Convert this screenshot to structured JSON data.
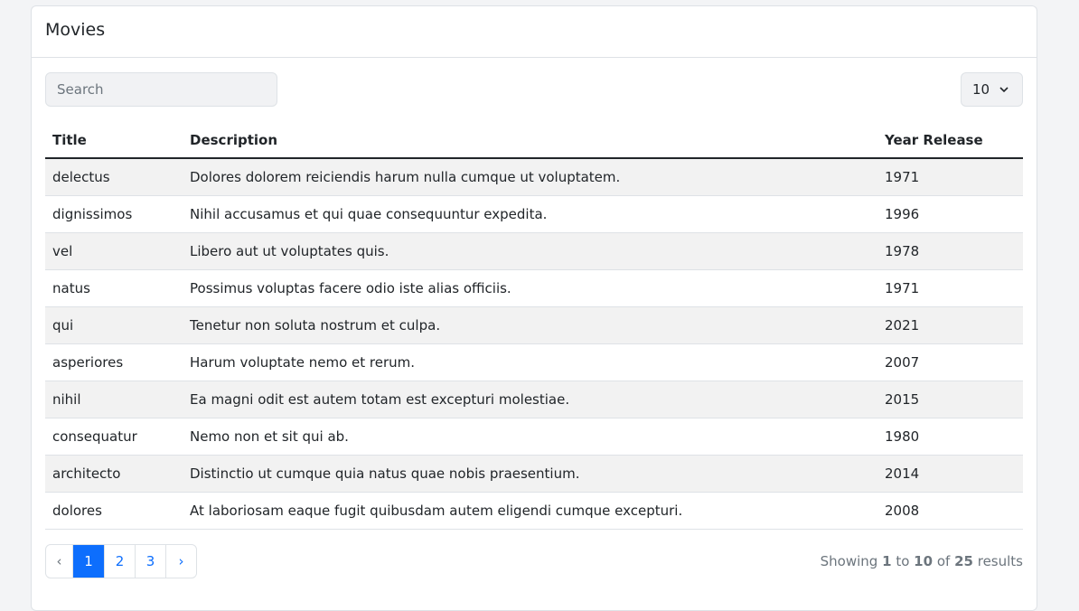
{
  "card": {
    "title": "Movies"
  },
  "search": {
    "placeholder": "Search",
    "value": ""
  },
  "per_page": {
    "value": "10"
  },
  "table": {
    "headers": [
      "Title",
      "Description",
      "Year Release"
    ],
    "rows": [
      [
        "delectus",
        "Dolores dolorem reiciendis harum nulla cumque ut voluptatem.",
        "1971"
      ],
      [
        "dignissimos",
        "Nihil accusamus et qui quae consequuntur expedita.",
        "1996"
      ],
      [
        "vel",
        "Libero aut ut voluptates quis.",
        "1978"
      ],
      [
        "natus",
        "Possimus voluptas facere odio iste alias officiis.",
        "1971"
      ],
      [
        "qui",
        "Tenetur non soluta nostrum et culpa.",
        "2021"
      ],
      [
        "asperiores",
        "Harum voluptate nemo et rerum.",
        "2007"
      ],
      [
        "nihil",
        "Ea magni odit est autem totam est excepturi molestiae.",
        "2015"
      ],
      [
        "consequatur",
        "Nemo non et sit qui ab.",
        "1980"
      ],
      [
        "architecto",
        "Distinctio ut cumque quia natus quae nobis praesentium.",
        "2014"
      ],
      [
        "dolores",
        "At laboriosam eaque fugit quibusdam autem eligendi cumque excepturi.",
        "2008"
      ]
    ]
  },
  "pagination": {
    "prev": "‹",
    "pages": [
      "1",
      "2",
      "3"
    ],
    "active": "1",
    "next": "›"
  },
  "info": {
    "showing": "Showing",
    "from": "1",
    "to_word": "to",
    "to": "10",
    "of_word": "of",
    "total": "25",
    "results": "results"
  },
  "colors": {
    "accent": "#0d6efd"
  }
}
